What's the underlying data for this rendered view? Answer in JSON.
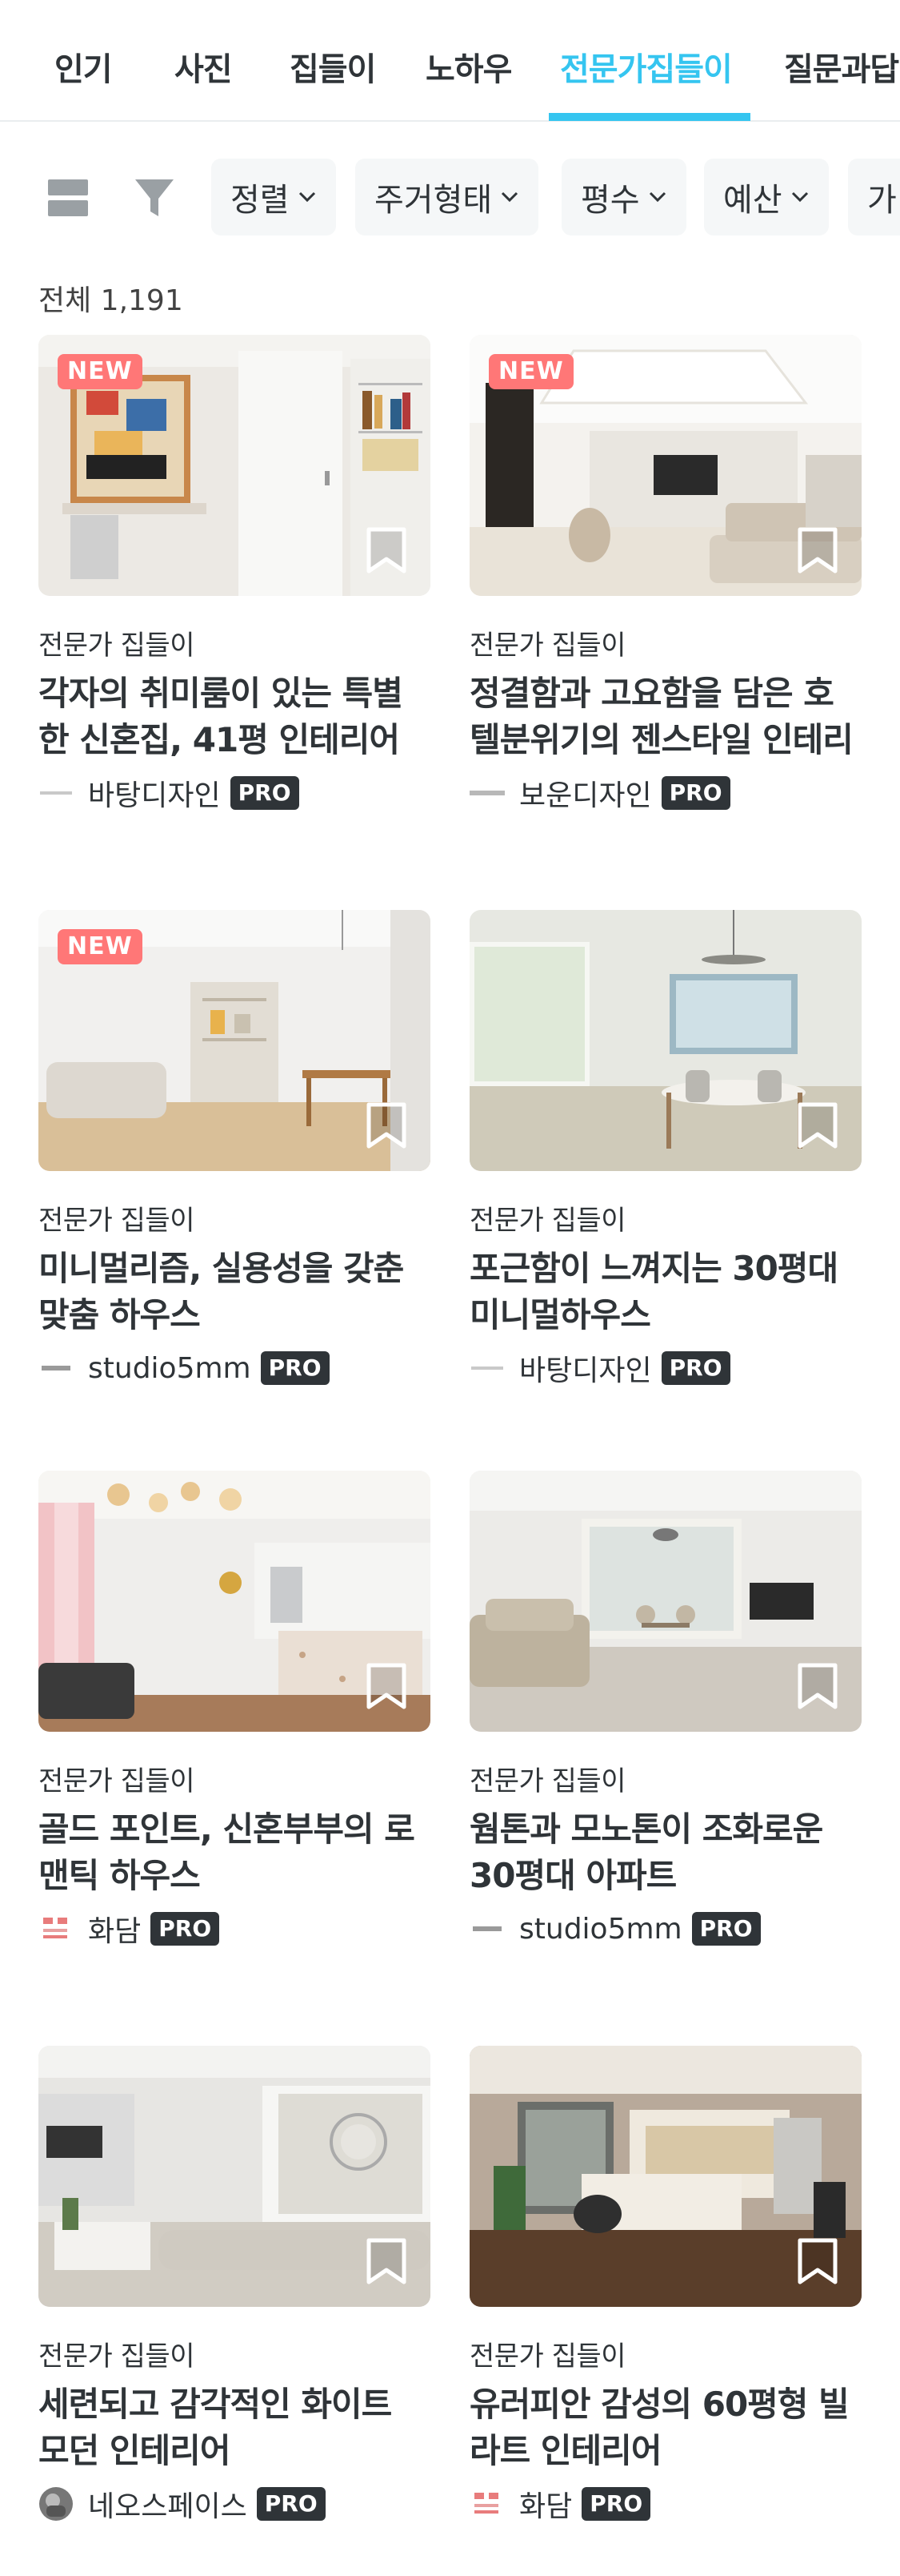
{
  "tabs": [
    {
      "label": "인기",
      "active": false
    },
    {
      "label": "사진",
      "active": false
    },
    {
      "label": "집들이",
      "active": false
    },
    {
      "label": "노하우",
      "active": false
    },
    {
      "label": "전문가집들이",
      "active": true
    },
    {
      "label": "질문과답",
      "active": false
    }
  ],
  "filters": {
    "chips": [
      "정렬",
      "주거형태",
      "평수",
      "예산",
      "가"
    ],
    "icons": [
      "layout-toggle-icon",
      "filter-icon"
    ]
  },
  "total_count": "전체 1,191",
  "colors": {
    "accent": "#35c5f0",
    "new_badge": "#ff7777",
    "pro_badge": "#2f3438"
  },
  "cards": [
    {
      "category": "전문가 집들이",
      "title": "각자의 취미룸이 있는 특별한 신혼집, 41평 인테리어",
      "author": "바탕디자인",
      "pro": "PRO",
      "new": "NEW",
      "logo": "badang"
    },
    {
      "category": "전문가 집들이",
      "title": "정결함과 고요함을 담은 호텔분위기의 젠스타일 인테리",
      "author": "보운디자인",
      "pro": "PRO",
      "new": "NEW",
      "logo": "bowoon"
    },
    {
      "category": "전문가 집들이",
      "title": "미니멀리즘, 실용성을 갖춘 맞춤 하우스",
      "author": "studio5mm",
      "pro": "PRO",
      "new": "NEW",
      "logo": "studio5mm"
    },
    {
      "category": "전문가 집들이",
      "title": "포근함이 느껴지는 30평대 미니멀하우스",
      "author": "바탕디자인",
      "pro": "PRO",
      "new": "",
      "logo": "badang"
    },
    {
      "category": "전문가 집들이",
      "title": "골드 포인트, 신혼부부의 로맨틱 하우스",
      "author": "화담",
      "pro": "PRO",
      "new": "",
      "logo": "hwadam"
    },
    {
      "category": "전문가 집들이",
      "title": "웜톤과 모노톤이 조화로운 30평대 아파트",
      "author": "studio5mm",
      "pro": "PRO",
      "new": "",
      "logo": "studio5mm"
    },
    {
      "category": "전문가 집들이",
      "title": "세련되고 감각적인 화이트 모던 인테리어",
      "author": "네오스페이스",
      "pro": "PRO",
      "new": "",
      "logo": "neospace"
    },
    {
      "category": "전문가 집들이",
      "title": "유러피안 감성의 60평형 빌라트 인테리어",
      "author": "화담",
      "pro": "PRO",
      "new": "",
      "logo": "hwadam"
    }
  ]
}
